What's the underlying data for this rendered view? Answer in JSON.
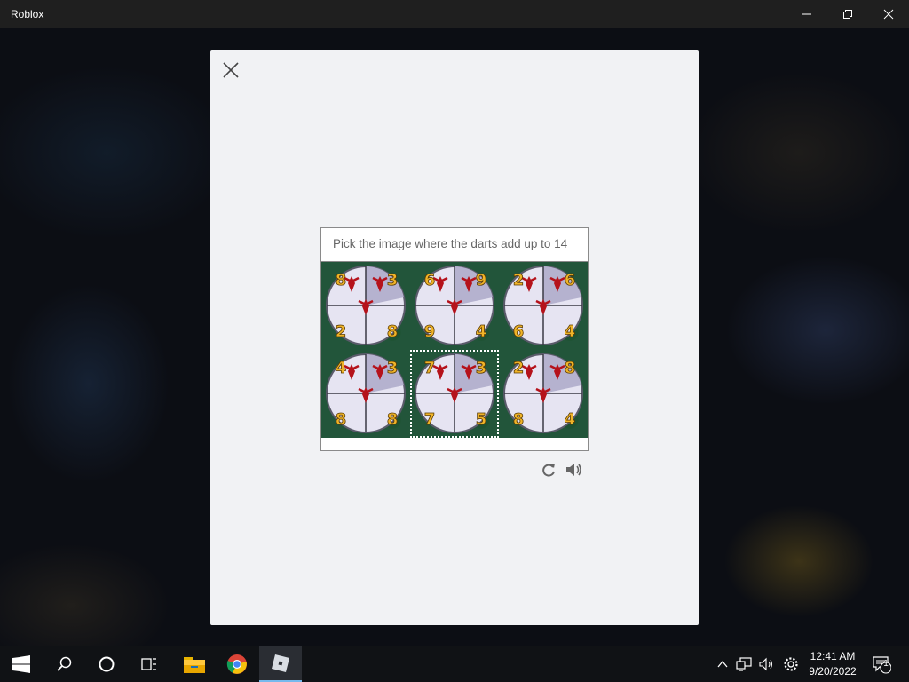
{
  "window": {
    "title": "Roblox",
    "controls": [
      "minimize-icon",
      "restore-icon",
      "close-icon"
    ]
  },
  "captcha": {
    "prompt": "Pick the image where the darts add up to 14",
    "tiles": [
      {
        "numbers": [
          "8",
          "3",
          "2",
          "8"
        ],
        "selected": false
      },
      {
        "numbers": [
          "6",
          "9",
          "9",
          "4"
        ],
        "selected": false
      },
      {
        "numbers": [
          "2",
          "6",
          "6",
          "4"
        ],
        "selected": false
      },
      {
        "numbers": [
          "4",
          "3",
          "8",
          "8"
        ],
        "selected": false
      },
      {
        "numbers": [
          "7",
          "3",
          "7",
          "5"
        ],
        "selected": true
      },
      {
        "numbers": [
          "2",
          "8",
          "8",
          "4"
        ],
        "selected": false
      }
    ],
    "tools": [
      "refresh-icon",
      "audio-icon"
    ]
  },
  "taskbar": {
    "items": [
      "windows-start-icon",
      "search-icon",
      "cortana-icon",
      "task-view-icon",
      "file-explorer-icon",
      "chrome-icon",
      "roblox-icon"
    ],
    "active": "roblox-icon",
    "tray": [
      "chevron-up-icon",
      "network-icon",
      "volume-icon",
      "settings-icon"
    ],
    "time": "12:41 AM",
    "date": "9/20/2022",
    "notification_count": "1"
  },
  "colors": {
    "title_bar": "#1f1f1f",
    "modal_bg": "#f1f2f4",
    "tile_green": "#22553a",
    "dart_red": "#b5121b",
    "number_gold": "#f0b429",
    "taskbar": "#101215",
    "taskbar_active_accent": "#76b9ed"
  }
}
